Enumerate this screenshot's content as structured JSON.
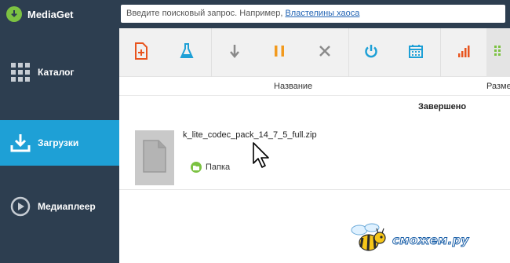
{
  "app": {
    "name": "MediaGet"
  },
  "search": {
    "prompt": "Введите поисковый запрос. Например, ",
    "example_link": "Властелины хаоса"
  },
  "sidebar": {
    "items": [
      {
        "label": "Каталог",
        "icon": "grid-icon",
        "active": false
      },
      {
        "label": "Загрузки",
        "icon": "download-icon",
        "active": true
      },
      {
        "label": "Медиаплеер",
        "icon": "play-icon",
        "active": false
      }
    ]
  },
  "toolbar": {
    "buttons": [
      {
        "icon": "add-torrent-icon",
        "color": "#e8541e"
      },
      {
        "icon": "flask-icon",
        "color": "#1ea0d6"
      },
      {
        "icon": "arrow-down-icon",
        "color": "#8a8a8a"
      },
      {
        "icon": "pause-icon",
        "color": "#f29a1e"
      },
      {
        "icon": "close-icon",
        "color": "#8a8a8a"
      },
      {
        "icon": "power-icon",
        "color": "#1ea0d6"
      },
      {
        "icon": "calendar-icon",
        "color": "#1ea0d6"
      },
      {
        "icon": "speed-bars-icon",
        "color": "#e8541e"
      },
      {
        "icon": "grid-view-icon",
        "color": "#7cc242"
      }
    ]
  },
  "columns": {
    "name": "Название",
    "size": "Разме"
  },
  "section_title": "Завершено",
  "download": {
    "filename": "k_lite_codec_pack_14_7_5_full.zip",
    "folder_label": "Папка"
  },
  "watermark": {
    "text": "сможем.ру"
  },
  "colors": {
    "sidebar_bg": "#2d3e50",
    "accent": "#1ea0d6",
    "brand_green": "#7cc242",
    "link": "#1f62b3"
  }
}
